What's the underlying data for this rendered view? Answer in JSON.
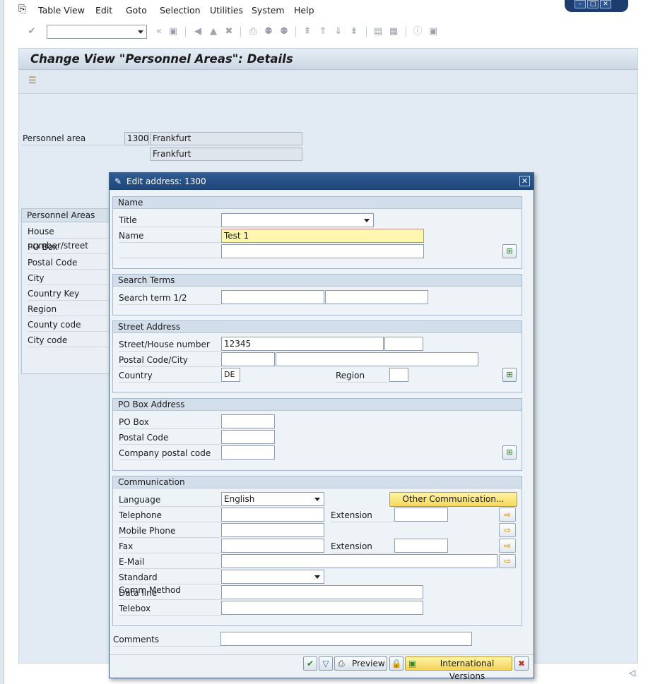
{
  "menu": {
    "items": [
      {
        "label": "Table View"
      },
      {
        "label": "Edit"
      },
      {
        "label": "Goto"
      },
      {
        "label": "Selection"
      },
      {
        "label": "Utilities"
      },
      {
        "label": "System"
      },
      {
        "label": "Help"
      }
    ]
  },
  "toolbar": {
    "command_value": ""
  },
  "page": {
    "title": "Change View \"Personnel Areas\": Details"
  },
  "personnel_area": {
    "label": "Personnel area",
    "code": "1300",
    "name": "Frankfurt",
    "name2": "Frankfurt"
  },
  "pa_box": {
    "header": "Personnel Areas",
    "rows": [
      "House number/street",
      "PO Box",
      "Postal Code",
      "City",
      "Country Key",
      "Region",
      "County code",
      "City code"
    ]
  },
  "dialog": {
    "title": "Edit address:  1300",
    "name_group": {
      "header": "Name",
      "title_label": "Title",
      "title_value": "",
      "name_label": "Name",
      "name_value": "Test 1",
      "name2_value": ""
    },
    "search_group": {
      "header": "Search Terms",
      "label": "Search term 1/2",
      "term1": "",
      "term2": ""
    },
    "street_group": {
      "header": "Street Address",
      "street_label": "Street/House number",
      "street_value": "12345",
      "house_value": "",
      "postal_label": "Postal Code/City",
      "postal_value": "",
      "city_value": "",
      "country_label": "Country",
      "country_value": "DE",
      "region_label": "Region",
      "region_value": ""
    },
    "pobox_group": {
      "header": "PO Box Address",
      "pobox_label": "PO Box",
      "postal_label": "Postal Code",
      "company_label": "Company postal code"
    },
    "comm_group": {
      "header": "Communication",
      "language_label": "Language",
      "language_value": "English",
      "other_comm_label": "Other Communication...",
      "telephone_label": "Telephone",
      "extension_label": "Extension",
      "mobile_label": "Mobile Phone",
      "fax_label": "Fax",
      "fax_extension_label": "Extension",
      "email_label": "E-Mail",
      "std_comm_label": "Standard Comm.Method",
      "dataline_label": "Data line",
      "telebox_label": "Telebox"
    },
    "comments_label": "Comments",
    "footer": {
      "preview_label": "Preview",
      "intl_label": "International Versions"
    }
  }
}
